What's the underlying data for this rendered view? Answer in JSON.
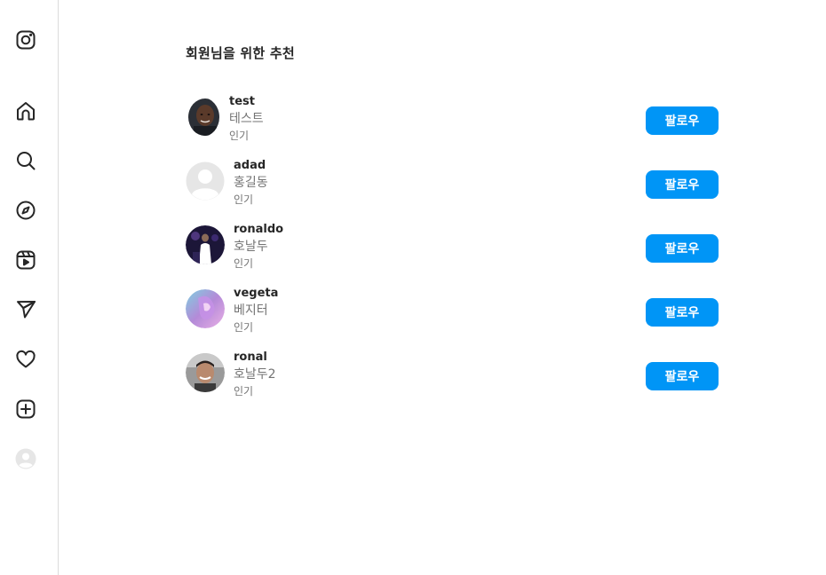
{
  "sidebar": {
    "items": [
      {
        "icon": "instagram-logo-icon"
      },
      {
        "icon": "home-icon"
      },
      {
        "icon": "search-icon"
      },
      {
        "icon": "explore-icon"
      },
      {
        "icon": "reels-icon"
      },
      {
        "icon": "messages-icon"
      },
      {
        "icon": "notifications-heart-icon"
      },
      {
        "icon": "create-plus-icon"
      },
      {
        "icon": "profile-avatar-icon"
      }
    ]
  },
  "main": {
    "title": "회원님을 위한 추천",
    "suggestions": [
      {
        "username": "test",
        "fullname": "테스트",
        "subtitle": "인기",
        "button": "팔로우",
        "avatar": "photo-dark"
      },
      {
        "username": "adad",
        "fullname": "홍길동",
        "subtitle": "인기",
        "button": "팔로우",
        "avatar": "default"
      },
      {
        "username": "ronaldo",
        "fullname": "호날두",
        "subtitle": "인기",
        "button": "팔로우",
        "avatar": "photo-purple"
      },
      {
        "username": "vegeta",
        "fullname": "베지터",
        "subtitle": "인기",
        "button": "팔로우",
        "avatar": "photo-pastel"
      },
      {
        "username": "ronal",
        "fullname": "호날두2",
        "subtitle": "인기",
        "button": "팔로우",
        "avatar": "photo-gray"
      }
    ]
  },
  "colors": {
    "accent": "#0095f6",
    "text_primary": "#262626",
    "text_secondary": "#737373",
    "border": "#dbdbdb"
  }
}
